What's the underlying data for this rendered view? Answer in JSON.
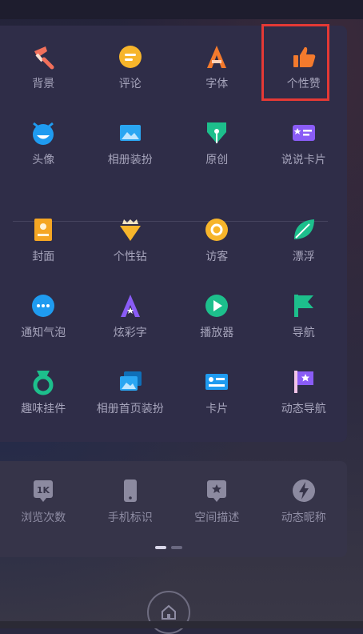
{
  "section1": [
    {
      "label": "背景",
      "icon": "brush-icon",
      "color": "#f2705b"
    },
    {
      "label": "评论",
      "icon": "comment-icon",
      "color": "#f7b52b"
    },
    {
      "label": "字体",
      "icon": "font-icon",
      "color": "#f47a2d"
    },
    {
      "label": "个性赞",
      "icon": "thumbs-up-icon",
      "color": "#f47a2d"
    },
    {
      "label": "头像",
      "icon": "avatar-icon",
      "color": "#1f9bf0"
    },
    {
      "label": "相册装扮",
      "icon": "album-icon",
      "color": "#2aa6f2"
    },
    {
      "label": "原创",
      "icon": "pen-nib-icon",
      "color": "#1dbf8c"
    },
    {
      "label": "说说卡片",
      "icon": "card-icon",
      "color": "#8a5cf6"
    }
  ],
  "section2": [
    {
      "label": "封面",
      "icon": "cover-icon",
      "color": "#f5a623"
    },
    {
      "label": "个性钻",
      "icon": "diamond-icon",
      "color": "#f7b52b"
    },
    {
      "label": "访客",
      "icon": "visitor-icon",
      "color": "#f7b52b"
    },
    {
      "label": "漂浮",
      "icon": "leaf-icon",
      "color": "#1dbf8c"
    },
    {
      "label": "通知气泡",
      "icon": "bubble-icon",
      "color": "#1f9bf0"
    },
    {
      "label": "炫彩字",
      "icon": "letter-a-icon",
      "color": "#8a5cf6"
    },
    {
      "label": "播放器",
      "icon": "play-icon",
      "color": "#1dbf8c"
    },
    {
      "label": "导航",
      "icon": "flag-icon",
      "color": "#1dbf8c"
    },
    {
      "label": "趣味挂件",
      "icon": "medal-icon",
      "color": "#1dbf8c"
    },
    {
      "label": "相册首页装扮",
      "icon": "album-stack-icon",
      "color": "#2aa6f2"
    },
    {
      "label": "卡片",
      "icon": "id-card-icon",
      "color": "#1f9bf0"
    },
    {
      "label": "动态导航",
      "icon": "star-flag-icon",
      "color": "#8a5cf6"
    }
  ],
  "section3": [
    {
      "label": "浏览次数",
      "icon": "views-1k-icon",
      "badge": "1K",
      "color": "#8c8aa0"
    },
    {
      "label": "手机标识",
      "icon": "phone-icon",
      "color": "#8c8aa0"
    },
    {
      "label": "空间描述",
      "icon": "star-badge-icon",
      "color": "#8c8aa0"
    },
    {
      "label": "动态昵称",
      "icon": "lightning-icon",
      "color": "#8c8aa0"
    }
  ]
}
